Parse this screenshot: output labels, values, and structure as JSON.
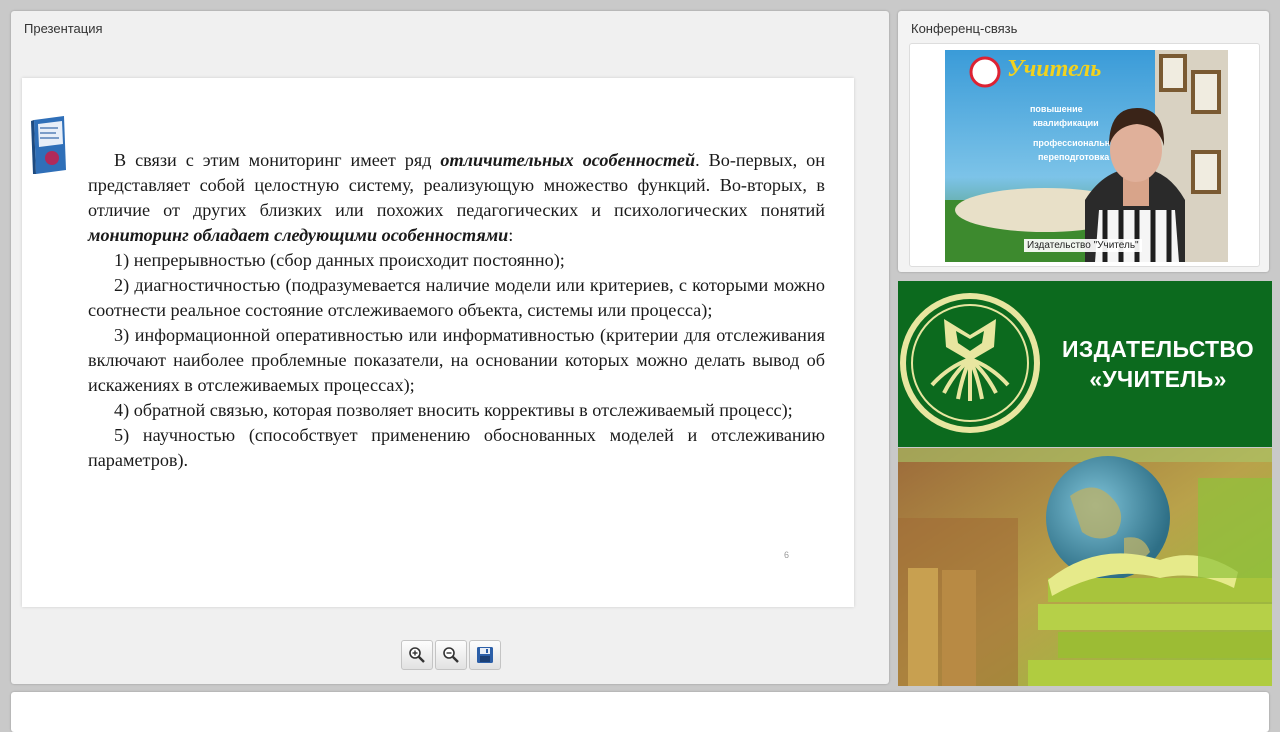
{
  "presentation": {
    "title": "Презентация",
    "slide": {
      "p1_a": "В связи с этим мониторинг имеет ряд ",
      "p1_em1": "отличительных особенностей",
      "p1_b": ". Во-первых, он представляет собой целостную систему, реализующую множество функций. Во-вторых, в отличие от других близких или похожих педагогических и психологических понятий ",
      "p1_em2": "мониторинг обладает следующими особенностями",
      "p1_c": ":",
      "item1": "1) непрерывностью (сбор данных происходит постоянно);",
      "item2": "2) диагностичностью (подразумевается наличие модели или критериев, с которыми можно соотнести реальное состояние отслеживаемого объекта, системы или процесса);",
      "item3": "3) информационной оперативностью или информативностью (критерии для отслеживания включают наиболее проблемные показатели, на основании которых можно делать вывод об искажениях в отслеживаемых процессах);",
      "item4": "4) обратной связью, которая позволяет вносить коррективы в отслеживаемый процесс);",
      "item5": "5) научностью (способствует применению обоснованных моделей и отслеживанию параметров).",
      "page_number": "6"
    },
    "tools": {
      "zoom_in_icon": "zoom-in-icon",
      "zoom_out_icon": "zoom-out-icon",
      "save_icon": "save-icon"
    }
  },
  "conference": {
    "title": "Конференц-связь",
    "video_caption": "Издательство \"Учитель\"",
    "background_sign": {
      "brand": "Учитель",
      "line1": "повышение",
      "line2": "квалификации",
      "line3": "профессиональная",
      "line4": "переподготовка"
    }
  },
  "banner": {
    "publisher_line1": "ИЗДАТЕЛЬСТВО",
    "publisher_line2": "«УЧИТЕЛЬ»",
    "brand_color": "#0c6a1e",
    "accent_color": "#e8e6a0"
  }
}
